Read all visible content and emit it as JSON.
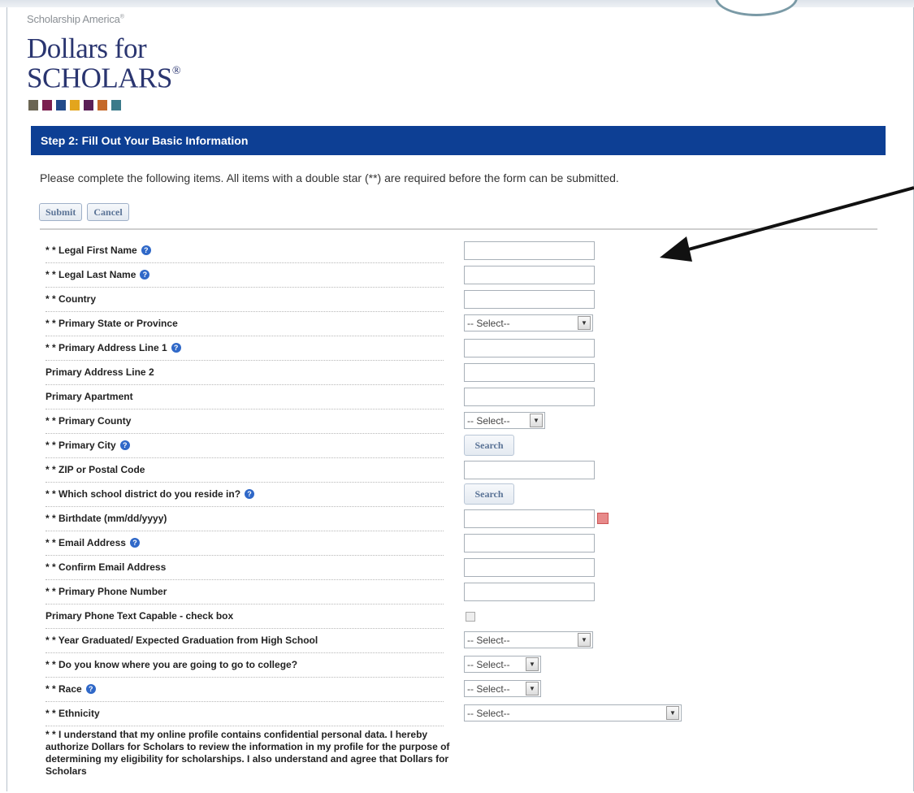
{
  "brand": {
    "org": "Scholarship America",
    "logo_line1": "Dollars for",
    "logo_line2": "SCHOLARS"
  },
  "squares": [
    "#6b6553",
    "#7b1e4f",
    "#224a8a",
    "#e3a51d",
    "#5a1f57",
    "#c5692a",
    "#3b7a8a"
  ],
  "step_header": "Step 2: Fill Out Your Basic Information",
  "instructions": "Please complete the following items. All items with a double star (**) are required before the form can be submitted.",
  "buttons": {
    "submit": "Submit",
    "cancel": "Cancel"
  },
  "fields": [
    {
      "label": "* * Legal First Name",
      "help": true,
      "control": "text"
    },
    {
      "label": "* * Legal Last Name",
      "help": true,
      "control": "text"
    },
    {
      "label": "* * Country",
      "help": false,
      "control": "text"
    },
    {
      "label": "* * Primary State or Province",
      "help": false,
      "control": "select",
      "value": "-- Select--"
    },
    {
      "label": "* * Primary Address Line 1",
      "help": true,
      "control": "text"
    },
    {
      "label": "Primary Address Line 2",
      "help": false,
      "control": "text"
    },
    {
      "label": "Primary Apartment",
      "help": false,
      "control": "text"
    },
    {
      "label": "* * Primary County",
      "help": false,
      "control": "select",
      "value": "-- Select--"
    },
    {
      "label": "* * Primary City",
      "help": true,
      "control": "search",
      "value": "Search"
    },
    {
      "label": "* * ZIP or Postal Code",
      "help": false,
      "control": "text"
    },
    {
      "label": "* * Which school district do you reside in?",
      "help": true,
      "control": "search",
      "value": "Search"
    },
    {
      "label": "* * Birthdate (mm/dd/yyyy)",
      "help": false,
      "control": "date"
    },
    {
      "label": "* * Email Address",
      "help": true,
      "control": "text"
    },
    {
      "label": "* * Confirm Email Address",
      "help": false,
      "control": "text"
    },
    {
      "label": "* * Primary Phone Number",
      "help": false,
      "control": "text"
    },
    {
      "label": "Primary Phone Text Capable - check box",
      "help": false,
      "control": "checkbox"
    },
    {
      "label": "* * Year Graduated/ Expected Graduation from High School",
      "help": false,
      "control": "select",
      "value": "-- Select--"
    },
    {
      "label": "* * Do you know where you are going to go to college?",
      "help": false,
      "control": "select",
      "value": "-- Select--"
    },
    {
      "label": "* * Race",
      "help": true,
      "control": "select",
      "value": "-- Select--"
    },
    {
      "label": "* * Ethnicity",
      "help": false,
      "control": "select",
      "value": "-- Select--"
    }
  ],
  "consent_text": "* * I understand that my online profile contains confidential personal data. I hereby authorize Dollars for Scholars to review the information in my profile for the purpose of determining my eligibility for scholarships. I also understand and agree that Dollars for Scholars"
}
